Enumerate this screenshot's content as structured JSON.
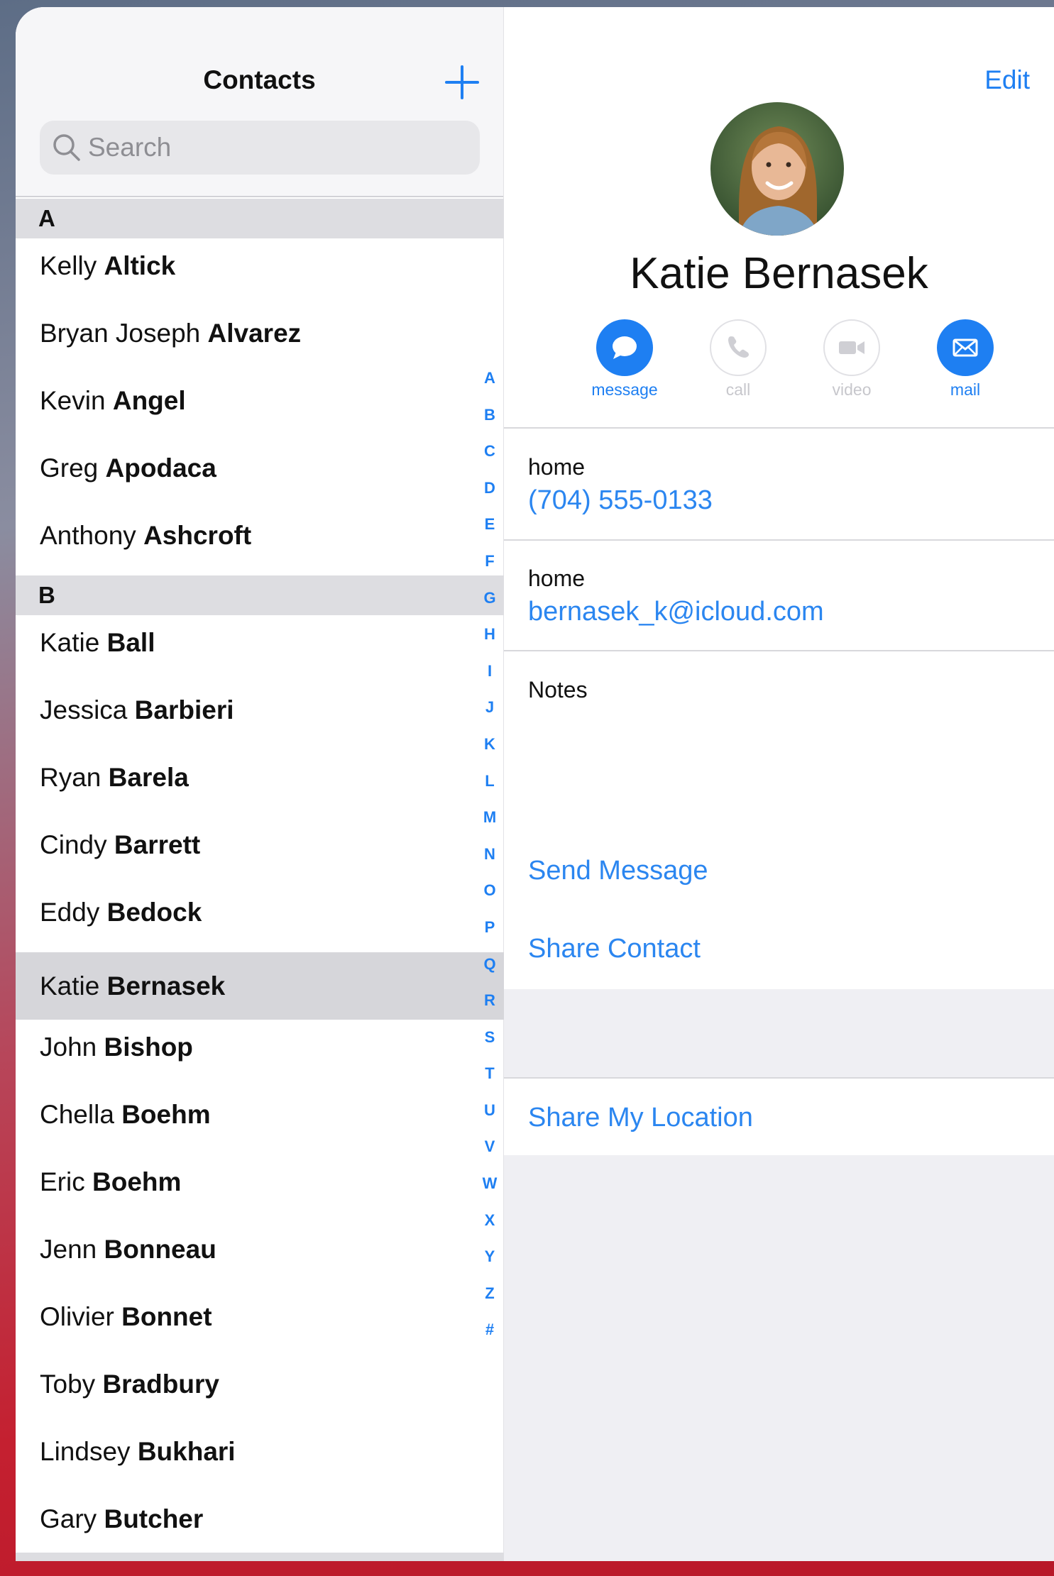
{
  "nav": {
    "title": "Contacts",
    "add_label": "+",
    "edit_label": "Edit"
  },
  "search": {
    "placeholder": "Search"
  },
  "sections": [
    {
      "letter": "A",
      "contacts": [
        {
          "first": "Kelly",
          "last": "Altick"
        },
        {
          "first": "Bryan Joseph",
          "last": "Alvarez"
        },
        {
          "first": "Kevin",
          "last": "Angel"
        },
        {
          "first": "Greg",
          "last": "Apodaca"
        },
        {
          "first": "Anthony",
          "last": "Ashcroft"
        }
      ]
    },
    {
      "letter": "B",
      "contacts": [
        {
          "first": "Katie",
          "last": "Ball"
        },
        {
          "first": "Jessica",
          "last": "Barbieri"
        },
        {
          "first": "Ryan",
          "last": "Barela"
        },
        {
          "first": "Cindy",
          "last": "Barrett"
        },
        {
          "first": "Eddy",
          "last": "Bedock"
        },
        {
          "first": "Katie",
          "last": "Bernasek",
          "selected": true
        },
        {
          "first": "John",
          "last": "Bishop"
        },
        {
          "first": "Chella",
          "last": "Boehm"
        },
        {
          "first": "Eric",
          "last": "Boehm"
        },
        {
          "first": "Jenn",
          "last": "Bonneau"
        },
        {
          "first": "Olivier",
          "last": "Bonnet"
        },
        {
          "first": "Toby",
          "last": "Bradbury"
        },
        {
          "first": "Lindsey",
          "last": "Bukhari"
        },
        {
          "first": "Gary",
          "last": "Butcher"
        }
      ]
    }
  ],
  "index_letters": [
    "A",
    "B",
    "C",
    "D",
    "E",
    "F",
    "G",
    "H",
    "I",
    "J",
    "K",
    "L",
    "M",
    "N",
    "O",
    "P",
    "Q",
    "R",
    "S",
    "T",
    "U",
    "V",
    "W",
    "X",
    "Y",
    "Z",
    "#"
  ],
  "contact": {
    "name": "Katie Bernasek",
    "actions": {
      "message": "message",
      "call": "call",
      "video": "video",
      "mail": "mail"
    },
    "phone": {
      "label": "home",
      "value": "(704) 555-0133"
    },
    "email": {
      "label": "home",
      "value": "bernasek_k@icloud.com"
    },
    "notes_label": "Notes",
    "send_message": "Send Message",
    "share_contact": "Share Contact",
    "share_location": "Share My Location"
  },
  "colors": {
    "accent": "#1e7ff2",
    "link": "#2b86f0",
    "disabled": "#c7c7cc"
  }
}
